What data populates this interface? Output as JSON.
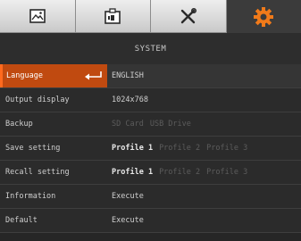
{
  "tabs": [
    {
      "icon": "image-icon",
      "active": false
    },
    {
      "icon": "camera-icon",
      "active": false
    },
    {
      "icon": "tools-icon",
      "active": false
    },
    {
      "icon": "gear-icon",
      "active": true
    }
  ],
  "section_title": "SYSTEM",
  "rows": [
    {
      "label": "Language",
      "values": [
        "ENGLISH"
      ]
    },
    {
      "label": "Output display",
      "values": [
        "1024x768"
      ]
    },
    {
      "label": "Backup",
      "values": [
        "SD Card",
        "USB Drive"
      ]
    },
    {
      "label": "Save setting",
      "values": [
        "Profile 1",
        "Profile 2",
        "Profile 3"
      ]
    },
    {
      "label": "Recall setting",
      "values": [
        "Profile 1",
        "Profile 2",
        "Profile 3"
      ]
    },
    {
      "label": "Information",
      "values": [
        "Execute"
      ]
    },
    {
      "label": "Default",
      "values": [
        "Execute"
      ]
    }
  ],
  "colors": {
    "accent": "#c04a10",
    "gear": "#f07a1a"
  }
}
